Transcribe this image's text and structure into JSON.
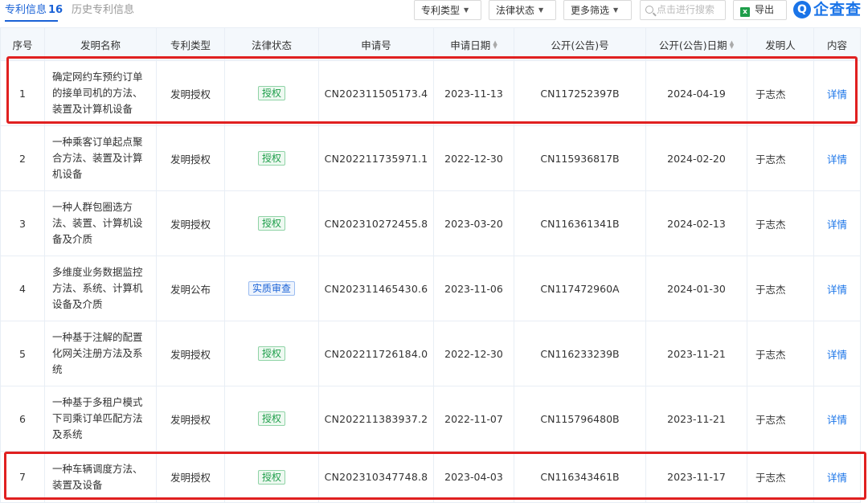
{
  "tabs": {
    "patent_label": "专利信息",
    "patent_count": "16",
    "history_label": "历史专利信息"
  },
  "toolbar": {
    "patent_type_label": "专利类型",
    "legal_status_label": "法律状态",
    "more_filters_label": "更多筛选",
    "search_placeholder": "点击进行搜索",
    "export_label": "导出",
    "export_icon": "excel-icon"
  },
  "brand": {
    "name": "企查查",
    "logo_color": "#1a74e8"
  },
  "colors": {
    "accent": "#1a62d6",
    "granted_tag": "#1e9e4a",
    "highlight_box": "#e02020"
  },
  "table": {
    "headers": [
      "序号",
      "发明名称",
      "专利类型",
      "法律状态",
      "申请号",
      "申请日期",
      "公开(公告)号",
      "公开(公告)日期",
      "发明人",
      "内容"
    ],
    "sortable_columns": [
      "申请日期",
      "公开(公告)日期"
    ],
    "rows": [
      {
        "index": "1",
        "name": "确定网约车预约订单的接单司机的方法、装置及计算机设备",
        "type": "发明授权",
        "status": "授权",
        "app_no": "CN202311505173.4",
        "app_date": "2023-11-13",
        "pub_no": "CN117252397B",
        "pub_date": "2024-04-19",
        "inventor": "于志杰",
        "detail": "详情"
      },
      {
        "index": "2",
        "name": "一种乘客订单起点聚合方法、装置及计算机设备",
        "type": "发明授权",
        "status": "授权",
        "app_no": "CN202211735971.1",
        "app_date": "2022-12-30",
        "pub_no": "CN115936817B",
        "pub_date": "2024-02-20",
        "inventor": "于志杰",
        "detail": "详情"
      },
      {
        "index": "3",
        "name": "一种人群包圈选方法、装置、计算机设备及介质",
        "type": "发明授权",
        "status": "授权",
        "app_no": "CN202310272455.8",
        "app_date": "2023-03-20",
        "pub_no": "CN116361341B",
        "pub_date": "2024-02-13",
        "inventor": "于志杰",
        "detail": "详情"
      },
      {
        "index": "4",
        "name": "多维度业务数据监控方法、系统、计算机设备及介质",
        "type": "发明公布",
        "status": "实质审查",
        "app_no": "CN202311465430.6",
        "app_date": "2023-11-06",
        "pub_no": "CN117472960A",
        "pub_date": "2024-01-30",
        "inventor": "于志杰",
        "detail": "详情"
      },
      {
        "index": "5",
        "name": "一种基于注解的配置化网关注册方法及系统",
        "type": "发明授权",
        "status": "授权",
        "app_no": "CN202211726184.0",
        "app_date": "2022-12-30",
        "pub_no": "CN116233239B",
        "pub_date": "2023-11-21",
        "inventor": "于志杰",
        "detail": "详情"
      },
      {
        "index": "6",
        "name": "一种基于多租户模式下司乘订单匹配方法及系统",
        "type": "发明授权",
        "status": "授权",
        "app_no": "CN202211383937.2",
        "app_date": "2022-11-07",
        "pub_no": "CN115796480B",
        "pub_date": "2023-11-21",
        "inventor": "于志杰",
        "detail": "详情"
      },
      {
        "index": "7",
        "name": "一种车辆调度方法、装置及设备",
        "type": "发明授权",
        "status": "授权",
        "app_no": "CN202310347748.8",
        "app_date": "2023-04-03",
        "pub_no": "CN116343461B",
        "pub_date": "2023-11-17",
        "inventor": "于志杰",
        "detail": "详情"
      }
    ]
  }
}
